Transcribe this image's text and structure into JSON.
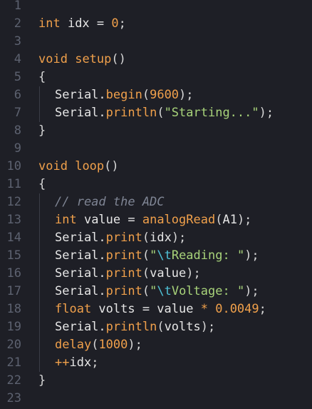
{
  "editor": {
    "lines": [
      {
        "n": "1",
        "indent": 0,
        "tokens": []
      },
      {
        "n": "2",
        "indent": 0,
        "tokens": [
          [
            "kw",
            "int"
          ],
          [
            "id",
            " idx = "
          ],
          [
            "num",
            "0"
          ],
          [
            "pun",
            ";"
          ]
        ]
      },
      {
        "n": "3",
        "indent": 0,
        "tokens": []
      },
      {
        "n": "4",
        "indent": 0,
        "tokens": [
          [
            "kw",
            "void"
          ],
          [
            "id",
            " "
          ],
          [
            "fn",
            "setup"
          ],
          [
            "pun",
            "()"
          ]
        ]
      },
      {
        "n": "5",
        "indent": 0,
        "tokens": [
          [
            "pun",
            "{"
          ]
        ]
      },
      {
        "n": "6",
        "indent": 1,
        "tokens": [
          [
            "id",
            "Serial."
          ],
          [
            "fn",
            "begin"
          ],
          [
            "pun",
            "("
          ],
          [
            "num",
            "9600"
          ],
          [
            "pun",
            ");"
          ]
        ]
      },
      {
        "n": "7",
        "indent": 1,
        "tokens": [
          [
            "id",
            "Serial."
          ],
          [
            "fn",
            "println"
          ],
          [
            "pun",
            "("
          ],
          [
            "str",
            "\"Starting...\""
          ],
          [
            "pun",
            ");"
          ]
        ]
      },
      {
        "n": "8",
        "indent": 0,
        "tokens": [
          [
            "pun",
            "}"
          ]
        ]
      },
      {
        "n": "9",
        "indent": 0,
        "tokens": []
      },
      {
        "n": "10",
        "indent": 0,
        "tokens": [
          [
            "kw",
            "void"
          ],
          [
            "id",
            " "
          ],
          [
            "fn",
            "loop"
          ],
          [
            "pun",
            "()"
          ]
        ]
      },
      {
        "n": "11",
        "indent": 0,
        "tokens": [
          [
            "pun",
            "{"
          ]
        ]
      },
      {
        "n": "12",
        "indent": 1,
        "tokens": [
          [
            "cmt",
            "// read the ADC"
          ]
        ]
      },
      {
        "n": "13",
        "indent": 1,
        "tokens": [
          [
            "kw",
            "int"
          ],
          [
            "id",
            " value = "
          ],
          [
            "fn",
            "analogRead"
          ],
          [
            "pun",
            "("
          ],
          [
            "id",
            "A1"
          ],
          [
            "pun",
            ");"
          ]
        ]
      },
      {
        "n": "14",
        "indent": 1,
        "tokens": [
          [
            "id",
            "Serial."
          ],
          [
            "fn",
            "print"
          ],
          [
            "pun",
            "("
          ],
          [
            "id",
            "idx"
          ],
          [
            "pun",
            ");"
          ]
        ]
      },
      {
        "n": "15",
        "indent": 1,
        "tokens": [
          [
            "id",
            "Serial."
          ],
          [
            "fn",
            "print"
          ],
          [
            "pun",
            "("
          ],
          [
            "str",
            "\""
          ],
          [
            "esc",
            "\\t"
          ],
          [
            "str",
            "Reading: \""
          ],
          [
            "pun",
            ");"
          ]
        ]
      },
      {
        "n": "16",
        "indent": 1,
        "tokens": [
          [
            "id",
            "Serial."
          ],
          [
            "fn",
            "print"
          ],
          [
            "pun",
            "("
          ],
          [
            "id",
            "value"
          ],
          [
            "pun",
            ");"
          ]
        ]
      },
      {
        "n": "17",
        "indent": 1,
        "tokens": [
          [
            "id",
            "Serial."
          ],
          [
            "fn",
            "print"
          ],
          [
            "pun",
            "("
          ],
          [
            "str",
            "\""
          ],
          [
            "esc",
            "\\t"
          ],
          [
            "str",
            "Voltage: \""
          ],
          [
            "pun",
            ");"
          ]
        ]
      },
      {
        "n": "18",
        "indent": 1,
        "tokens": [
          [
            "kw",
            "float"
          ],
          [
            "id",
            " volts = value "
          ],
          [
            "kw",
            "*"
          ],
          [
            "id",
            " "
          ],
          [
            "num",
            "0.0049"
          ],
          [
            "pun",
            ";"
          ]
        ]
      },
      {
        "n": "19",
        "indent": 1,
        "tokens": [
          [
            "id",
            "Serial."
          ],
          [
            "fn",
            "println"
          ],
          [
            "pun",
            "("
          ],
          [
            "id",
            "volts"
          ],
          [
            "pun",
            ");"
          ]
        ]
      },
      {
        "n": "20",
        "indent": 1,
        "tokens": [
          [
            "fn",
            "delay"
          ],
          [
            "pun",
            "("
          ],
          [
            "num",
            "1000"
          ],
          [
            "pun",
            ");"
          ]
        ]
      },
      {
        "n": "21",
        "indent": 1,
        "tokens": [
          [
            "kw",
            "++"
          ],
          [
            "id",
            "idx"
          ],
          [
            "pun",
            ";"
          ]
        ]
      },
      {
        "n": "22",
        "indent": 0,
        "tokens": [
          [
            "pun",
            "}"
          ]
        ]
      },
      {
        "n": "23",
        "indent": 0,
        "tokens": []
      }
    ]
  }
}
